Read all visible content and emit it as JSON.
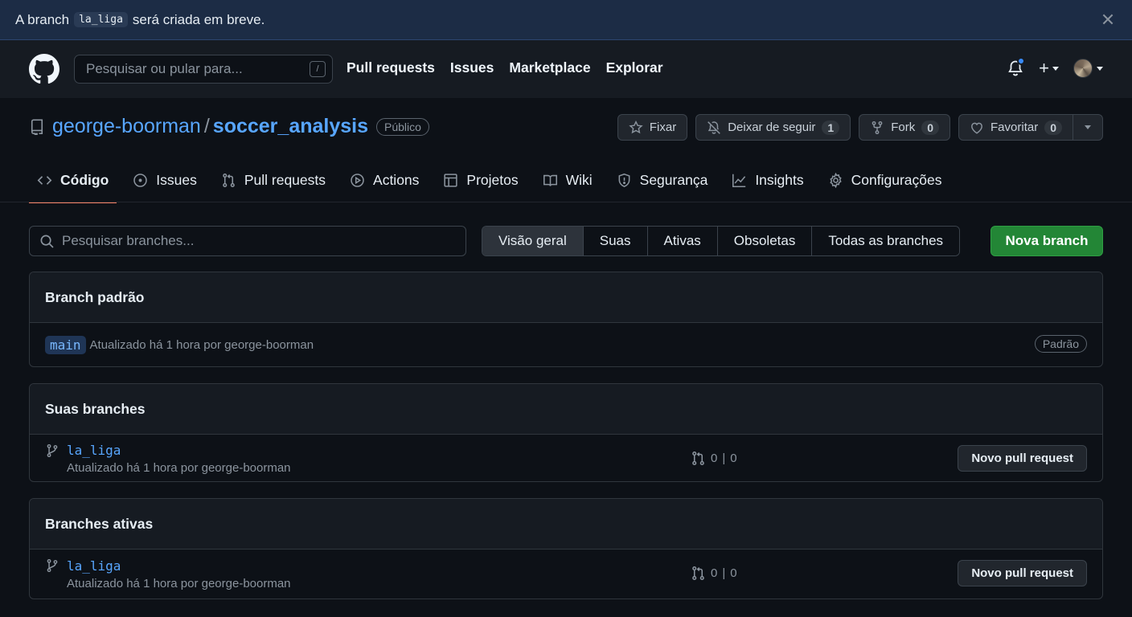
{
  "flash": {
    "text_before": "A branch",
    "branch": "la_liga",
    "text_after": "será criada em breve."
  },
  "header": {
    "search_placeholder": "Pesquisar ou pular para...",
    "search_shortcut": "/",
    "nav": [
      "Pull requests",
      "Issues",
      "Marketplace",
      "Explorar"
    ],
    "plus_label": "+"
  },
  "repo": {
    "owner": "george-boorman",
    "separator": "/",
    "name": "soccer_analysis",
    "visibility": "Público",
    "pin_label": "Fixar",
    "unwatch_label": "Deixar de seguir",
    "unwatch_count": "1",
    "fork_label": "Fork",
    "fork_count": "0",
    "star_label": "Favoritar",
    "star_count": "0"
  },
  "tabs": [
    {
      "label": "Código",
      "icon": "code-icon"
    },
    {
      "label": "Issues",
      "icon": "issue-icon"
    },
    {
      "label": "Pull requests",
      "icon": "pull-request-icon"
    },
    {
      "label": "Actions",
      "icon": "play-icon"
    },
    {
      "label": "Projetos",
      "icon": "table-icon"
    },
    {
      "label": "Wiki",
      "icon": "book-icon"
    },
    {
      "label": "Segurança",
      "icon": "shield-icon"
    },
    {
      "label": "Insights",
      "icon": "graph-icon"
    },
    {
      "label": "Configurações",
      "icon": "gear-icon"
    }
  ],
  "branches": {
    "search_placeholder": "Pesquisar branches...",
    "filters": [
      "Visão geral",
      "Suas",
      "Ativas",
      "Obsoletas",
      "Todas as branches"
    ],
    "new_branch_label": "Nova branch",
    "default": {
      "title": "Branch padrão",
      "name": "main",
      "meta": "Atualizado há 1 hora por george-boorman",
      "badge": "Padrão"
    },
    "yours": {
      "title": "Suas branches",
      "name": "la_liga",
      "meta": "Atualizado há 1 hora por george-boorman",
      "behind": "0",
      "bar": "|",
      "ahead": "0",
      "pr_label": "Novo pull request"
    },
    "active": {
      "title": "Branches ativas",
      "name": "la_liga",
      "meta": "Atualizado há 1 hora por george-boorman",
      "behind": "0",
      "bar": "|",
      "ahead": "0",
      "pr_label": "Novo pull request"
    }
  },
  "colors": {
    "background": "#0d1117",
    "header": "#161b22",
    "flash": "#1c2c45",
    "link": "#58a6ff",
    "primary_button": "#238636",
    "active_tab_underline": "#f78166",
    "notification_dot": "#388bfd"
  }
}
